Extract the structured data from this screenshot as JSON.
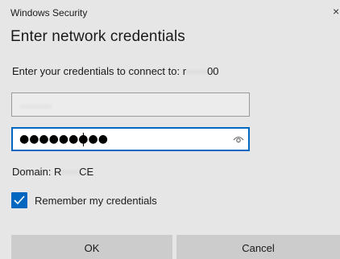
{
  "window": {
    "title": "Windows Security",
    "close_glyph": "×"
  },
  "dialog": {
    "heading": "Enter network credentials",
    "prompt_prefix": "Enter your credentials to connect to:",
    "prompt_host_start": "r",
    "prompt_host_obscured": "······",
    "prompt_host_end": "00"
  },
  "username": {
    "value_obscured": "·········"
  },
  "password": {
    "masked_value": "●●●●●●●●●",
    "reveal_icon": "eye-icon"
  },
  "domain": {
    "label_prefix": "Domain: R",
    "obscured": "·····",
    "label_suffix": "CE"
  },
  "remember": {
    "label": "Remember my credentials",
    "checked": true
  },
  "buttons": {
    "ok": "OK",
    "cancel": "Cancel"
  },
  "colors": {
    "accent": "#0067c0",
    "background": "#e6e6e6",
    "button": "#cccccc"
  }
}
